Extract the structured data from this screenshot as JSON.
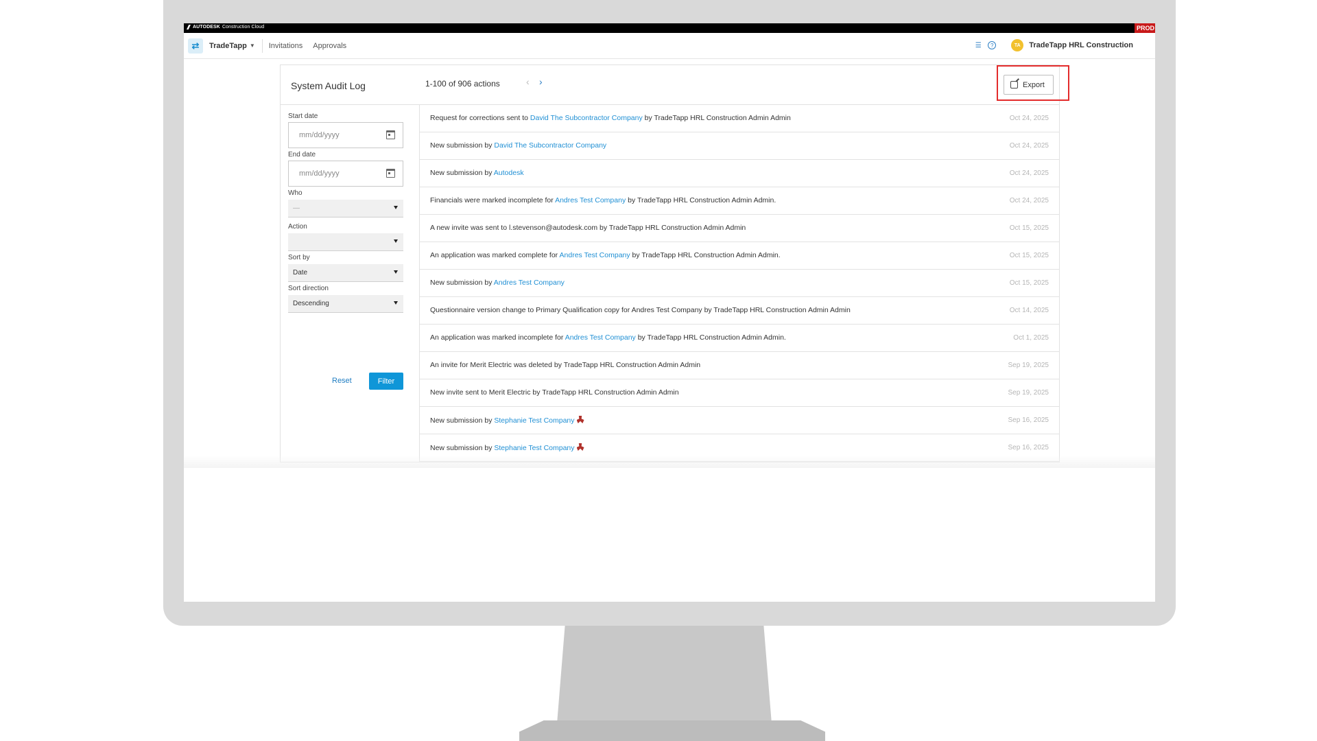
{
  "banner": {
    "brand_bold": "AUTODESK",
    "brand_rest": "Construction Cloud",
    "env_badge": "PROD"
  },
  "nav": {
    "app_name": "TradeTapp",
    "links": [
      "Invitations",
      "Approvals"
    ],
    "avatar_initials": "TA",
    "account_name": "TradeTapp HRL Construction"
  },
  "header": {
    "title": "System Audit Log",
    "range": "1-100 of 906 actions",
    "export_label": "Export"
  },
  "filters": {
    "start_date_label": "Start date",
    "start_date_placeholder": "mm/dd/yyyy",
    "end_date_label": "End date",
    "end_date_placeholder": "mm/dd/yyyy",
    "who_label": "Who",
    "who_value": "—",
    "action_label": "Action",
    "action_value": "",
    "sort_by_label": "Sort by",
    "sort_by_value": "Date",
    "sort_direction_label": "Sort direction",
    "sort_direction_value": "Descending",
    "reset_label": "Reset",
    "filter_label": "Filter"
  },
  "log": [
    {
      "pre": "Request for corrections sent to ",
      "link": "David The Subcontractor Company",
      "post": " by TradeTapp HRL Construction Admin Admin",
      "date": "Oct 24, 2025",
      "flag": false
    },
    {
      "pre": "New submission by ",
      "link": "David The Subcontractor Company",
      "post": "",
      "date": "Oct 24, 2025",
      "flag": false
    },
    {
      "pre": "New submission by ",
      "link": "Autodesk",
      "post": "",
      "date": "Oct 24, 2025",
      "flag": false
    },
    {
      "pre": "Financials were marked incomplete for ",
      "link": "Andres Test Company",
      "post": " by TradeTapp HRL Construction Admin Admin.",
      "date": "Oct 24, 2025",
      "flag": false
    },
    {
      "pre": "A new invite was sent to l.stevenson@autodesk.com by TradeTapp HRL Construction Admin Admin",
      "link": "",
      "post": "",
      "date": "Oct 15, 2025",
      "flag": false
    },
    {
      "pre": "An application was marked complete for ",
      "link": "Andres Test Company",
      "post": " by TradeTapp HRL Construction Admin Admin.",
      "date": "Oct 15, 2025",
      "flag": false
    },
    {
      "pre": "New submission by ",
      "link": "Andres Test Company",
      "post": "",
      "date": "Oct 15, 2025",
      "flag": false
    },
    {
      "pre": "Questionnaire version change to Primary Qualification copy for Andres Test Company by TradeTapp HRL Construction Admin Admin",
      "link": "",
      "post": "",
      "date": "Oct 14, 2025",
      "flag": false
    },
    {
      "pre": "An application was marked incomplete for ",
      "link": "Andres Test Company",
      "post": " by TradeTapp HRL Construction Admin Admin.",
      "date": "Oct 1, 2025",
      "flag": false
    },
    {
      "pre": "An invite for Merit Electric was deleted by TradeTapp HRL Construction Admin Admin",
      "link": "",
      "post": "",
      "date": "Sep 19, 2025",
      "flag": false
    },
    {
      "pre": "New invite sent to Merit Electric by TradeTapp HRL Construction Admin Admin",
      "link": "",
      "post": "",
      "date": "Sep 19, 2025",
      "flag": false
    },
    {
      "pre": "New submission by ",
      "link": "Stephanie Test Company",
      "post": "",
      "date": "Sep 16, 2025",
      "flag": true
    },
    {
      "pre": "New submission by ",
      "link": "Stephanie Test Company",
      "post": "",
      "date": "Sep 16, 2025",
      "flag": true
    }
  ]
}
